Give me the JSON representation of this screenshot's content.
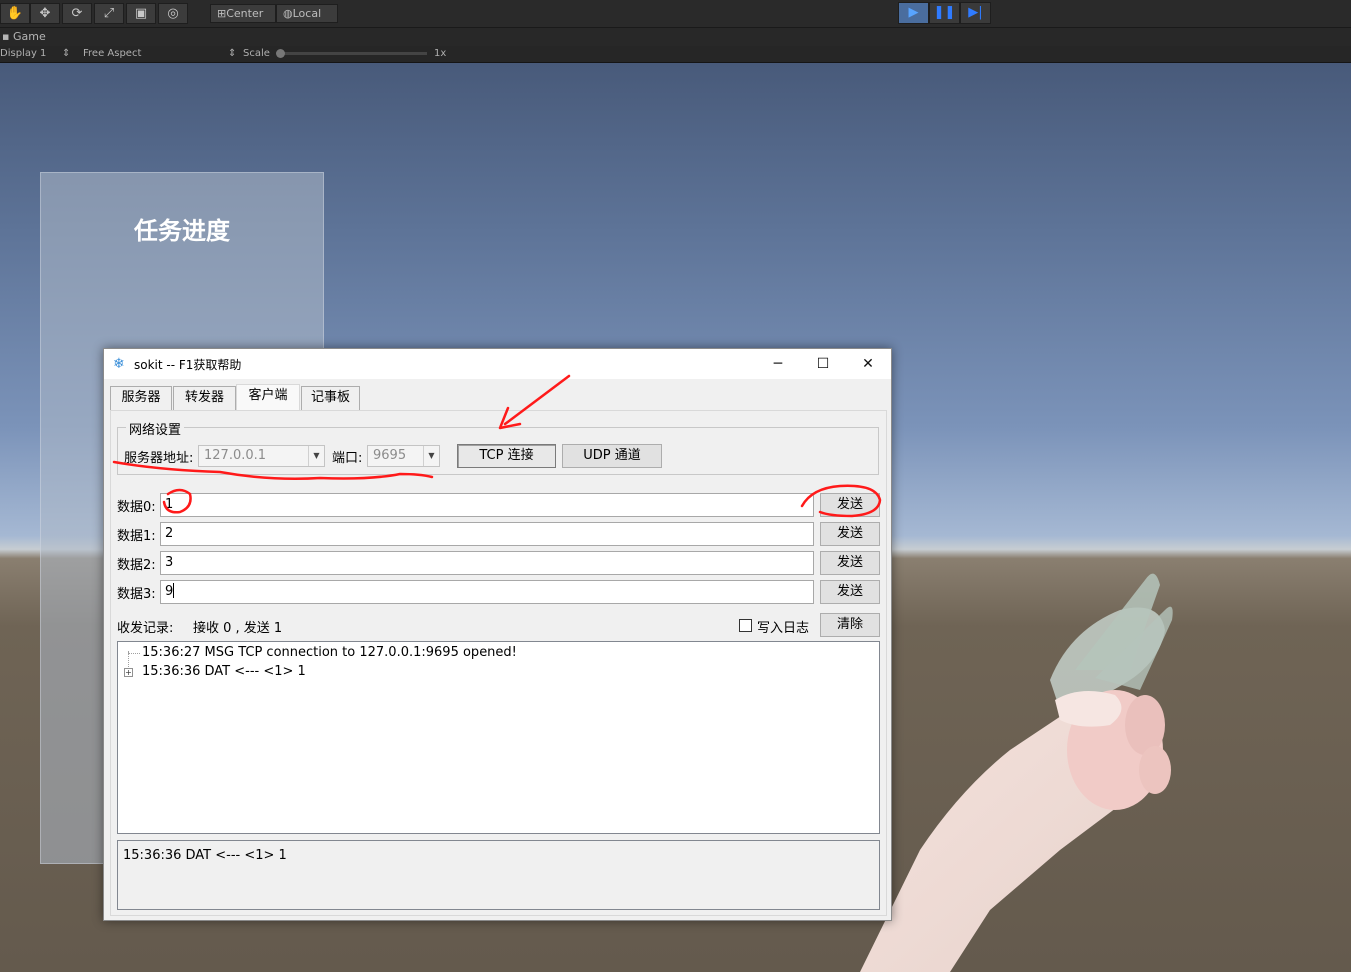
{
  "unity": {
    "pivot_center_label": "Center",
    "pivot_local_label": "Local",
    "game_tab_label": "Game",
    "display_label": "Display 1",
    "aspect_label": "Free Aspect",
    "scale_label": "Scale",
    "scale_value": "1x"
  },
  "scene": {
    "panel_title": "任务进度"
  },
  "sokit": {
    "title": "sokit -- F1获取帮助",
    "tabs": [
      "服务器",
      "转发器",
      "客户端",
      "记事板"
    ],
    "active_tab": "客户端",
    "network_group_label": "网络设置",
    "server_addr_label": "服务器地址:",
    "server_addr_value": "127.0.0.1",
    "port_label": "端口:",
    "port_value": "9695",
    "tcp_button": "TCP 连接",
    "udp_button": "UDP 通道",
    "data_rows": [
      {
        "label": "数据0:",
        "value": "1",
        "send": "发送"
      },
      {
        "label": "数据1:",
        "value": "2",
        "send": "发送"
      },
      {
        "label": "数据2:",
        "value": "3",
        "send": "发送"
      },
      {
        "label": "数据3:",
        "value": "9",
        "send": "发送"
      }
    ],
    "record_label": "收发记录:",
    "record_stats": "接收 0 , 发送 1",
    "write_log_label": "写入日志",
    "write_log_checked": false,
    "clear_button": "清除",
    "log_lines": [
      "15:36:27 MSG TCP connection to 127.0.0.1:9695 opened!",
      "15:36:36 DAT <--- <1> 1"
    ],
    "detail_text": "15:36:36 DAT <--- <1> 1"
  }
}
